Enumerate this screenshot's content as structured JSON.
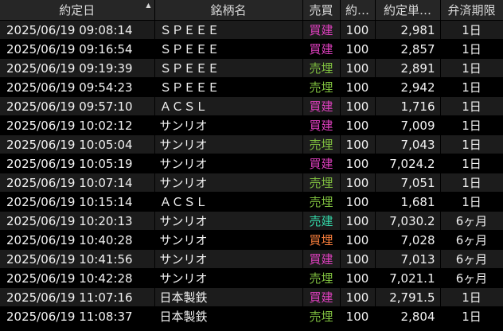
{
  "headers": {
    "date": "約定日",
    "name": "銘柄名",
    "side": "売買",
    "qty": "約…",
    "price": "約定単…",
    "limit": "弁済期限"
  },
  "colors": {
    "buy_new": "#e040c0",
    "sell_close": "#7fbf3f",
    "sell_new": "#34d7a8",
    "buy_close": "#f07a3a"
  },
  "icons": {
    "sort": "sort-ascending-icon"
  },
  "rows": [
    {
      "date": "2025/06/19 09:08:14",
      "name": "ＳＰＥＥＥ",
      "side": "買建",
      "side_type": "buy_new",
      "qty": "100",
      "price": "2,981",
      "limit": "1日"
    },
    {
      "date": "2025/06/19 09:16:54",
      "name": "ＳＰＥＥＥ",
      "side": "買建",
      "side_type": "buy_new",
      "qty": "100",
      "price": "2,857",
      "limit": "1日"
    },
    {
      "date": "2025/06/19 09:19:39",
      "name": "ＳＰＥＥＥ",
      "side": "売埋",
      "side_type": "sell_close",
      "qty": "100",
      "price": "2,891",
      "limit": "1日"
    },
    {
      "date": "2025/06/19 09:54:23",
      "name": "ＳＰＥＥＥ",
      "side": "売埋",
      "side_type": "sell_close",
      "qty": "100",
      "price": "2,942",
      "limit": "1日"
    },
    {
      "date": "2025/06/19 09:57:10",
      "name": "ＡＣＳＬ",
      "side": "買建",
      "side_type": "buy_new",
      "qty": "100",
      "price": "1,716",
      "limit": "1日"
    },
    {
      "date": "2025/06/19 10:02:12",
      "name": "サンリオ",
      "side": "買建",
      "side_type": "buy_new",
      "qty": "100",
      "price": "7,009",
      "limit": "1日"
    },
    {
      "date": "2025/06/19 10:05:04",
      "name": "サンリオ",
      "side": "売埋",
      "side_type": "sell_close",
      "qty": "100",
      "price": "7,043",
      "limit": "1日"
    },
    {
      "date": "2025/06/19 10:05:19",
      "name": "サンリオ",
      "side": "買建",
      "side_type": "buy_new",
      "qty": "100",
      "price": "7,024.2",
      "limit": "1日"
    },
    {
      "date": "2025/06/19 10:07:14",
      "name": "サンリオ",
      "side": "売埋",
      "side_type": "sell_close",
      "qty": "100",
      "price": "7,051",
      "limit": "1日"
    },
    {
      "date": "2025/06/19 10:15:14",
      "name": "ＡＣＳＬ",
      "side": "売埋",
      "side_type": "sell_close",
      "qty": "100",
      "price": "1,681",
      "limit": "1日"
    },
    {
      "date": "2025/06/19 10:20:13",
      "name": "サンリオ",
      "side": "売建",
      "side_type": "sell_new",
      "qty": "100",
      "price": "7,030.2",
      "limit": "6ヶ月"
    },
    {
      "date": "2025/06/19 10:40:28",
      "name": "サンリオ",
      "side": "買埋",
      "side_type": "buy_close",
      "qty": "100",
      "price": "7,028",
      "limit": "6ヶ月"
    },
    {
      "date": "2025/06/19 10:41:56",
      "name": "サンリオ",
      "side": "買建",
      "side_type": "buy_new",
      "qty": "100",
      "price": "7,013",
      "limit": "6ヶ月"
    },
    {
      "date": "2025/06/19 10:42:28",
      "name": "サンリオ",
      "side": "売埋",
      "side_type": "sell_close",
      "qty": "100",
      "price": "7,021.1",
      "limit": "6ヶ月"
    },
    {
      "date": "2025/06/19 11:07:16",
      "name": "日本製鉄",
      "side": "買建",
      "side_type": "buy_new",
      "qty": "100",
      "price": "2,791.5",
      "limit": "1日"
    },
    {
      "date": "2025/06/19 11:08:37",
      "name": "日本製鉄",
      "side": "売埋",
      "side_type": "sell_close",
      "qty": "100",
      "price": "2,804",
      "limit": "1日"
    }
  ]
}
